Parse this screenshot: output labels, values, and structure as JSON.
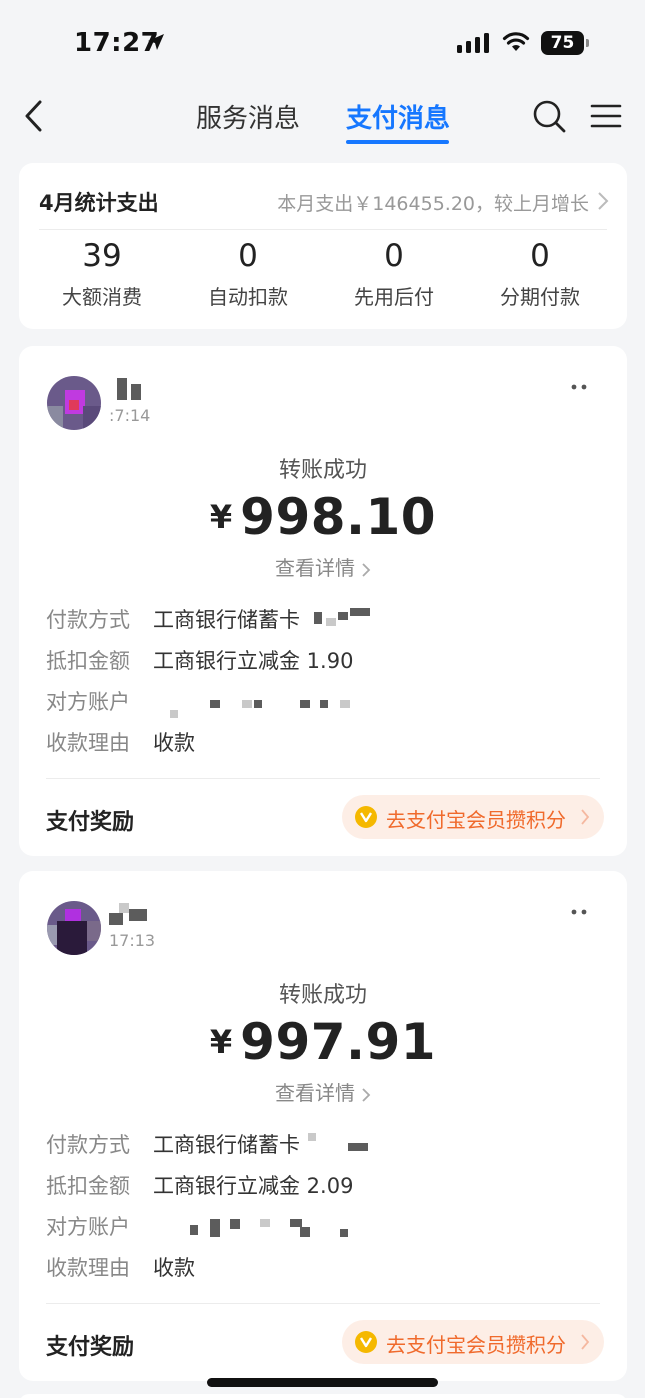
{
  "status_bar": {
    "time": "17:27",
    "battery": "75"
  },
  "nav": {
    "tabs": [
      "服务消息",
      "支付消息"
    ],
    "active_tab": "支付消息"
  },
  "summary": {
    "title": "4月统计支出",
    "description": "本月支出￥146455.20，较上月增长",
    "stats": [
      {
        "value": "39",
        "label": "大额消费"
      },
      {
        "value": "0",
        "label": "自动扣款"
      },
      {
        "value": "0",
        "label": "先用后付"
      },
      {
        "value": "0",
        "label": "分期付款"
      }
    ]
  },
  "messages": [
    {
      "time": ":7:14",
      "status": "转账成功",
      "currency": "¥",
      "amount": "998.10",
      "detail_link": "查看详情",
      "rows": [
        {
          "label": "付款方式",
          "value": "工商银行储蓄卡"
        },
        {
          "label": "抵扣金额",
          "value": "工商银行立减金 1.90"
        },
        {
          "label": "对方账户",
          "value": ""
        },
        {
          "label": "收款理由",
          "value": "收款"
        }
      ],
      "reward_label": "支付奖励",
      "reward_button": "去支付宝会员攒积分"
    },
    {
      "time": "17:13",
      "status": "转账成功",
      "currency": "¥",
      "amount": "997.91",
      "detail_link": "查看详情",
      "rows": [
        {
          "label": "付款方式",
          "value": "工商银行储蓄卡"
        },
        {
          "label": "抵扣金额",
          "value": "工商银行立减金 2.09"
        },
        {
          "label": "对方账户",
          "value": ""
        },
        {
          "label": "收款理由",
          "value": "收款"
        }
      ],
      "reward_label": "支付奖励",
      "reward_button": "去支付宝会员攒积分"
    }
  ],
  "colors": {
    "accent": "#1677ff",
    "reward": "#f06a2c",
    "reward_bg": "#fdeee6"
  }
}
